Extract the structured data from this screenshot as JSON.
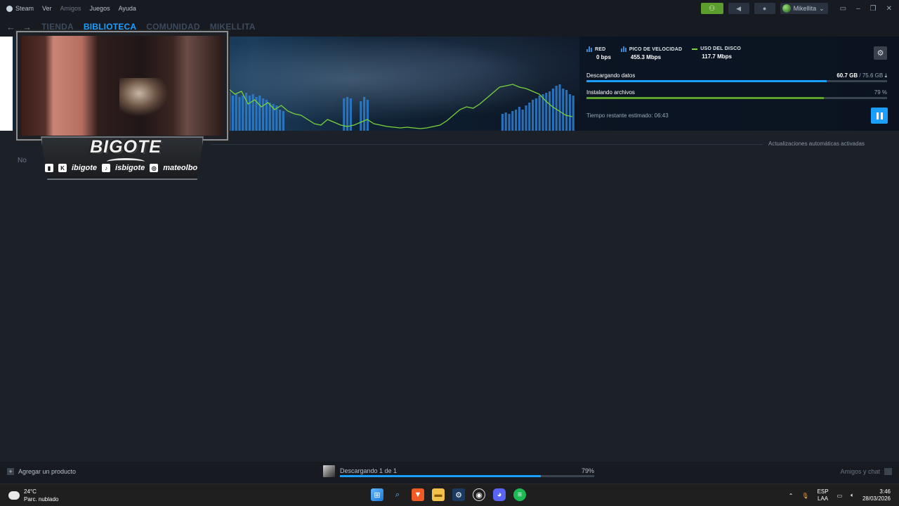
{
  "menu": {
    "items": [
      "Steam",
      "Ver",
      "Amigos",
      "Juegos",
      "Ayuda"
    ]
  },
  "user": {
    "name": "Mikellita"
  },
  "nav": {
    "tabs": [
      "TIENDA",
      "BIBLIOTECA",
      "COMUNIDAD",
      "MIKELLITA"
    ],
    "active": "BIBLIOTECA"
  },
  "stats": {
    "red_label": "RED",
    "red_value": "0 bps",
    "peak_label": "PICO DE VELOCIDAD",
    "peak_value": "455.3 Mbps",
    "disk_label": "USO DEL DISCO",
    "disk_value": "117.7 Mbps"
  },
  "download": {
    "label": "Descargando datos",
    "downloaded": "60.7 GB",
    "separator": "/",
    "total": "75.6 GB",
    "progress": 0.8
  },
  "install": {
    "label": "Instalando archivos",
    "percent_text": "79 %",
    "progress": 0.79
  },
  "time_remaining": "Tiempo restante estimado: 06:43",
  "auto_updates": "Actualizaciones automáticas activadas",
  "no_label": "No",
  "overlay": {
    "brand": "BIGOTE",
    "socials": [
      "ibigote",
      "isbigote",
      "mateolbo"
    ]
  },
  "bottom": {
    "add_product": "Agregar un producto",
    "download_status": "Descargando 1 de 1",
    "download_percent": "79%",
    "download_progress": 0.79,
    "friends_chat": "Amigos y chat"
  },
  "taskbar": {
    "temp": "24°C",
    "weather": "Parc. nublado",
    "lang_top": "ESP",
    "lang_bottom": "LAA",
    "time": "3:46",
    "date": "28/03/2026"
  },
  "colors": {
    "accent": "#1a9fff",
    "install_green": "#5ba32b",
    "graph_line": "#79d43a",
    "graph_bars": "#2d7fd0"
  }
}
